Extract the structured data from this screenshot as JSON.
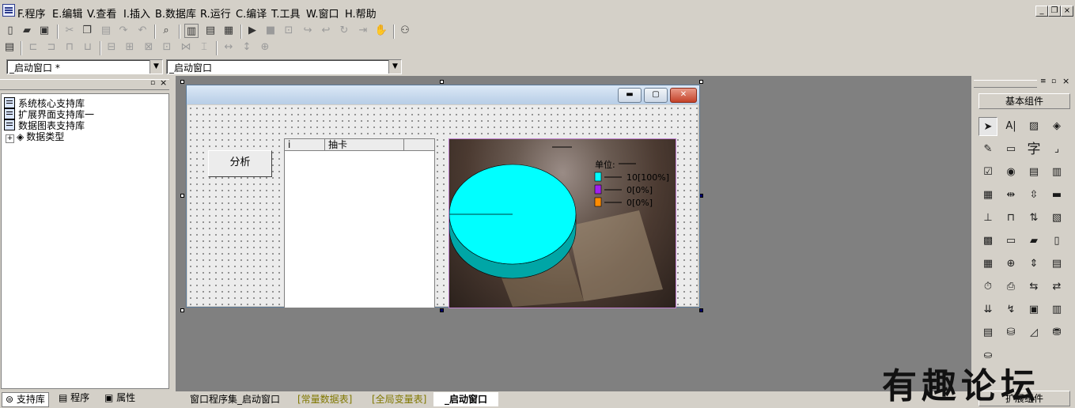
{
  "menu": {
    "items": [
      "F.程序",
      "E.编辑",
      "V.查看",
      "I.插入",
      "B.数据库",
      "R.运行",
      "C.编译",
      "T.工具",
      "W.窗口",
      "H.帮助"
    ]
  },
  "toolbar": {
    "combo_left": "_启动窗口 *",
    "combo_right": "_启动窗口"
  },
  "left_panel": {
    "tree": [
      "系统核心支持库",
      "扩展界面支持库一",
      "数据图表支持库",
      "数据类型"
    ],
    "tabs": [
      "支持库",
      "程序",
      "属性"
    ]
  },
  "form": {
    "button_label": "分析",
    "list_columns": [
      "i",
      "抽卡"
    ],
    "chart": {
      "unit_label": "单位:",
      "legend": [
        "10[100%]",
        "0[0%]",
        "0[0%]"
      ],
      "colors": [
        "#00ffff",
        "#a020f0",
        "#ff8c00"
      ]
    }
  },
  "chart_data": {
    "type": "pie",
    "categories": [
      "10[100%]",
      "0[0%]",
      "0[0%]"
    ],
    "values": [
      10,
      0,
      0
    ],
    "title": "",
    "xlabel": "",
    "ylabel": "单位:"
  },
  "right_panel": {
    "basic_header": "基本组件",
    "ext_header": "扩展组件"
  },
  "bottom_tabs": [
    "窗口程序集_启动窗口",
    "[常量数据表]",
    "[全局变量表]",
    "_启动窗口"
  ],
  "watermark": "有趣论坛"
}
